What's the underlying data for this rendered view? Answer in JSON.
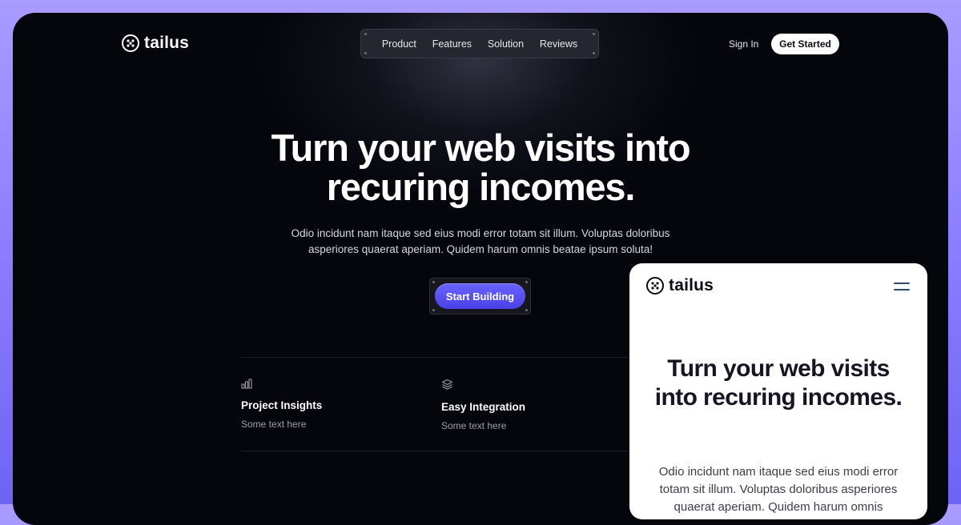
{
  "brand": {
    "name": "tailus"
  },
  "nav": {
    "items": [
      "Product",
      "Features",
      "Solution",
      "Reviews"
    ]
  },
  "header": {
    "signin_label": "Sign In",
    "cta_label": "Get Started"
  },
  "hero": {
    "title": "Turn your web visits into recuring incomes.",
    "text": "Odio incidunt nam itaque sed eius modi error totam sit illum. Voluptas doloribus asperiores quaerat aperiam. Quidem harum omnis beatae ipsum soluta!",
    "cta_label": "Start Building"
  },
  "features": [
    {
      "icon": "bar-chart-icon",
      "title": "Project Insights",
      "text": "Some text here"
    },
    {
      "icon": "layers-icon",
      "title": "Easy Integration",
      "text": "Some text here"
    }
  ],
  "mobile_preview": {
    "brand": "tailus",
    "menu_icon": "hamburger-menu-icon",
    "title": "Turn your web visits into recuring incomes.",
    "text": "Odio incidunt nam itaque sed eius modi error totam sit illum. Voluptas doloribus asperiores quaerat aperiam. Quidem harum omnis beatae ipsum soluta!"
  },
  "colors": {
    "outer_background": "#8d80ff",
    "page_background": "#05060c",
    "accent": "#4b41e6",
    "text_primary": "#ffffff",
    "text_muted": "#9c9dac"
  }
}
